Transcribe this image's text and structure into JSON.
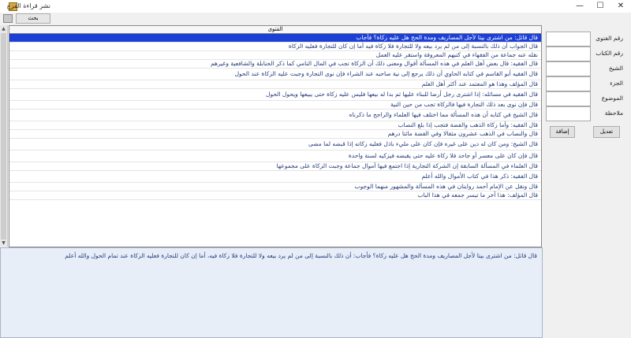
{
  "window": {
    "title": "نشر قراءة الفرح",
    "minimize_glyph": "—",
    "maximize_glyph": "☐",
    "close_glyph": "✕"
  },
  "toolbar": {
    "search_label": "بحث"
  },
  "grid": {
    "header": "الفتوى",
    "rows": [
      "قال قائل: من اشترى بيتا لأجل المصاريف ومدة الحج هل عليه زكاة؟ فأجاب",
      "قال الجواب أن ذلك بالنسبة إلى من لم يرد بيعه ولا للتجارة فلا زكاة فيه أما إن كان للتجارة فعليه الزكاة",
      "نقله عنه جماعة من الفقهاء في كتبهم المعروفة واستقر عليه العمل",
      "قال الفقيه: قال بعض أهل العلم في هذه المسألة أقوال ومعنى ذلك أن الزكاة تجب في المال النامي كما ذكر الحنابلة والشافعية وغيرهم",
      "قال الفقيه أبو القاسم في كتابه الحاوي أن ذلك يرجع إلى نية صاحبه عند الشراء فإن نوى التجارة وجبت عليه الزكاة عند الحول",
      "قال المؤلف وهذا هو المعتمد عند أكثر أهل العلم",
      "قال الفقيه في مسائله: إذا اشترى رجل أرضا للبناء عليها ثم بدا له بيعها فليس عليه زكاة حتى يبيعها ويحول الحول",
      "قال فإن نوى بعد ذلك التجارة فيها فالزكاة تجب من حين النية",
      "قال الشيخ في كتابه أن هذه المسألة مما اختلف فيها العلماء والراجح ما ذكرناه",
      "قال الفقيه: وأما زكاة الذهب والفضة فتجب إذا بلغ النصاب",
      "قال والنصاب في الذهب عشرون مثقالا وفي الفضة مائتا درهم",
      "قال الشيخ: ومن كان له دين على غيره فإن كان على مليء باذل فعليه زكاته إذا قبضه لما مضى",
      "قال فإن كان على معسر أو جاحد فلا زكاة عليه حتى يقبضه فيزكيه لسنة واحدة",
      "قال العلماء في المسألة السابقة إن الشركة التجارية إذا اجتمع فيها أموال جماعة وجبت الزكاة على مجموعها",
      "قال الفقيه: ذكر هذا في كتاب الأموال والله أعلم",
      "قال ونقل عن الإمام أحمد روايتان في هذه المسألة والمشهور منهما الوجوب",
      "قال المؤلف: هذا آخر ما تيسر جمعه في هذا الباب"
    ]
  },
  "detail": {
    "text": "قال قائل: من اشترى بيتا لأجل المصاريف ومدة الحج هل عليه زكاة؟ فأجاب: أن ذلك بالنسبة إلى من لم يرد بيعه ولا للتجارة فلا زكاة فيه، أما إن كان للتجارة فعليه الزكاة عند تمام الحول والله أعلم"
  },
  "form": {
    "labels": [
      "رقم الفتوى",
      "رقم الكتاب",
      "الشيخ",
      "الجزء",
      "الموضوع",
      "ملاحظة"
    ],
    "add_button": "إضافة",
    "edit_button": "تعديل"
  }
}
